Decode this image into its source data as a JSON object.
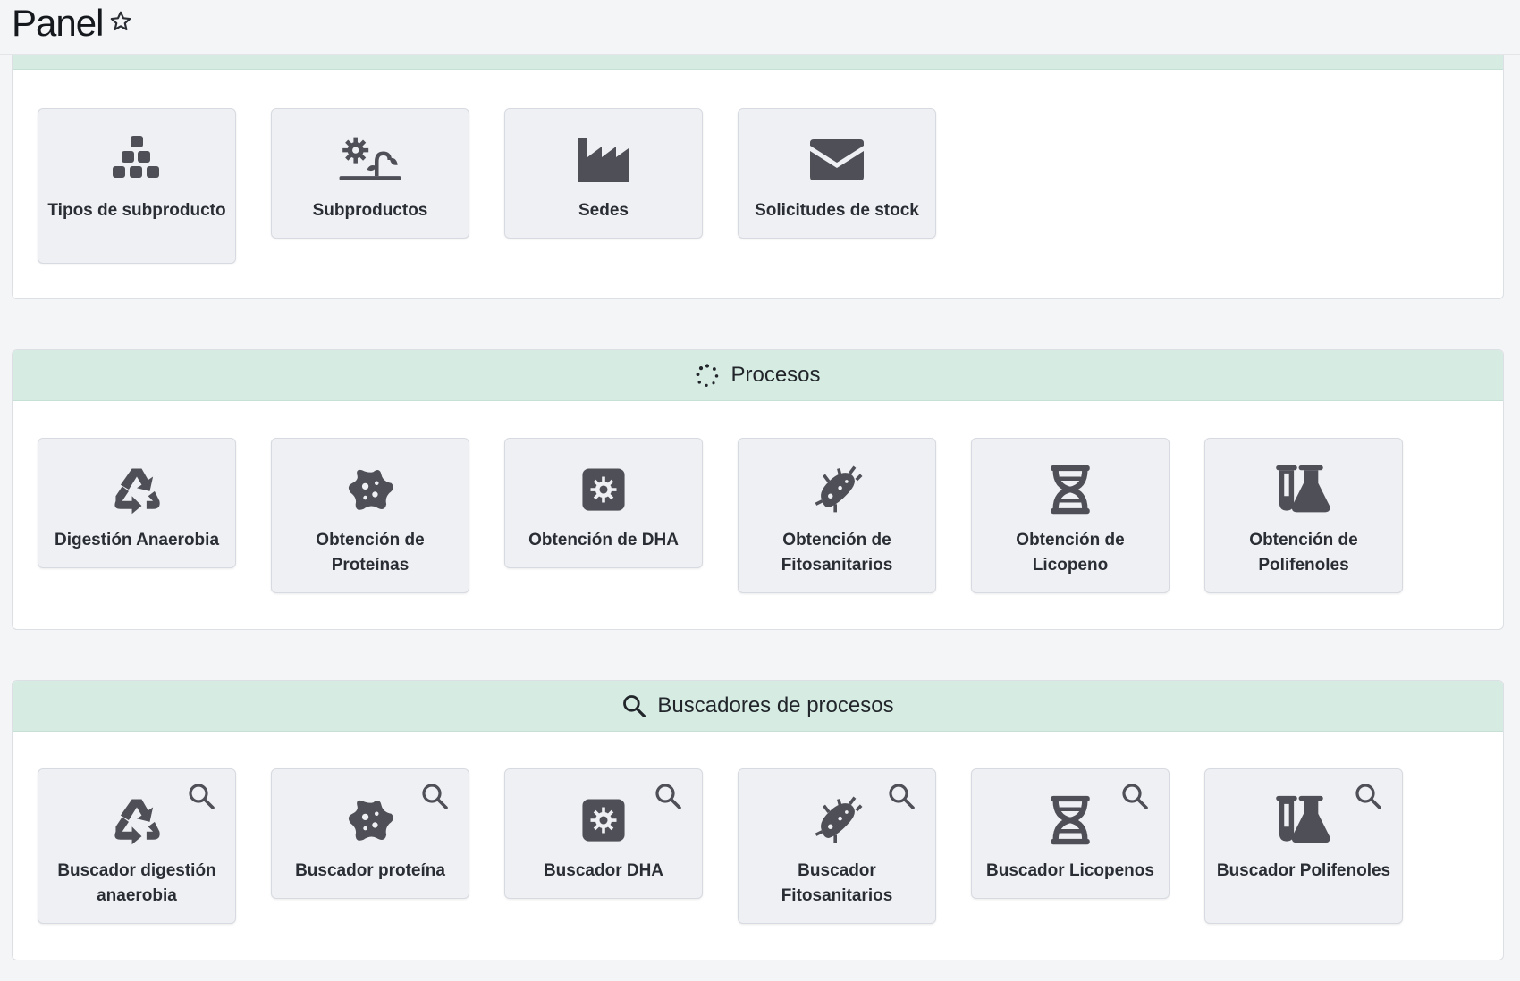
{
  "header": {
    "title": "Panel"
  },
  "sections": {
    "top": {
      "tiles": [
        {
          "label": "Tipos de subproducto",
          "icon": "cubes-icon"
        },
        {
          "label": "Subproductos",
          "icon": "gear-plant-icon"
        },
        {
          "label": "Sedes",
          "icon": "factory-icon"
        },
        {
          "label": "Solicitudes de stock",
          "icon": "envelope-icon"
        }
      ]
    },
    "procesos": {
      "title": "Procesos",
      "icon": "spinner-icon",
      "tiles": [
        {
          "label": "Digestión Anaerobia",
          "icon": "recycle-icon"
        },
        {
          "label": "Obtención de Proteínas",
          "icon": "bacterium-icon"
        },
        {
          "label": "Obtención de DHA",
          "icon": "virus-box-icon"
        },
        {
          "label": "Obtención de Fitosanitarios",
          "icon": "bacillus-icon"
        },
        {
          "label": "Obtención de Licopeno",
          "icon": "dna-icon"
        },
        {
          "label": "Obtención de Polifenoles",
          "icon": "flask-vial-icon"
        }
      ]
    },
    "buscadores": {
      "title": "Buscadores de procesos",
      "icon": "search-icon",
      "tiles": [
        {
          "label": "Buscador digestión anaerobia",
          "icon": "recycle-icon"
        },
        {
          "label": "Buscador proteína",
          "icon": "bacterium-icon"
        },
        {
          "label": "Buscador DHA",
          "icon": "virus-box-icon"
        },
        {
          "label": "Buscador Fitosanitarios",
          "icon": "bacillus-icon"
        },
        {
          "label": "Buscador Licopenos",
          "icon": "dna-icon"
        },
        {
          "label": "Buscador Polifenoles",
          "icon": "flask-vial-icon"
        }
      ]
    }
  },
  "colors": {
    "icon": "#4f4f58",
    "header_bg": "#d6ece3",
    "tile_bg": "#eef0f4"
  }
}
